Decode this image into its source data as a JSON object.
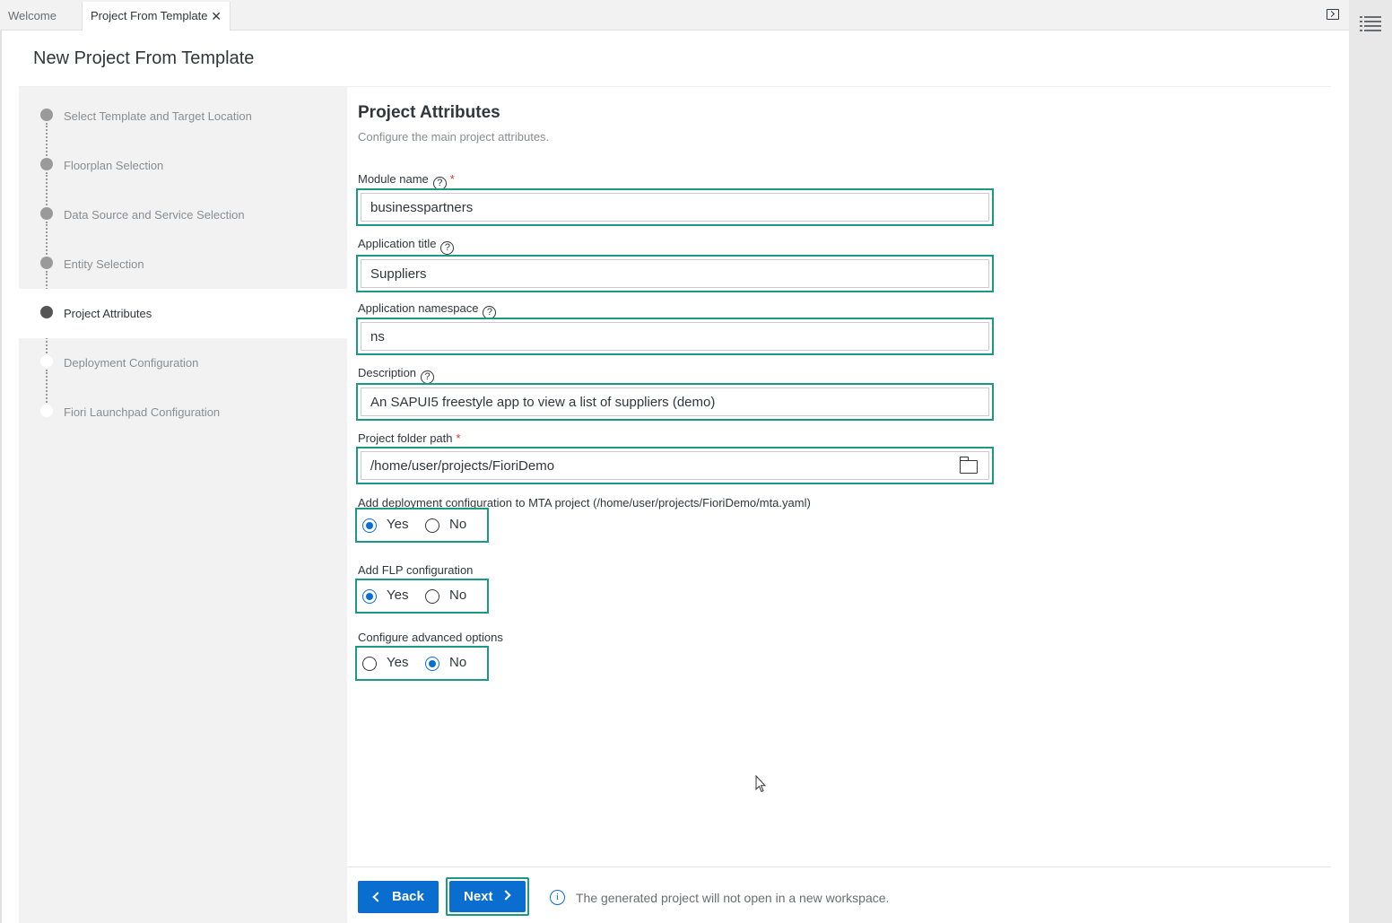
{
  "tabs": {
    "welcome": "Welcome",
    "active": "Project From Template",
    "close_glyph": "✕"
  },
  "page": {
    "title": "New Project From Template"
  },
  "wizard": {
    "steps": [
      {
        "label": "Select Template and Target Location",
        "state": "done"
      },
      {
        "label": "Floorplan Selection",
        "state": "done"
      },
      {
        "label": "Data Source and Service Selection",
        "state": "done"
      },
      {
        "label": "Entity Selection",
        "state": "done"
      },
      {
        "label": "Project Attributes",
        "state": "current"
      },
      {
        "label": "Deployment Configuration",
        "state": "future"
      },
      {
        "label": "Fiori Launchpad Configuration",
        "state": "future"
      }
    ]
  },
  "section": {
    "title": "Project Attributes",
    "subtitle": "Configure the main project attributes."
  },
  "fields": {
    "module_name": {
      "label": "Module name",
      "value": "businesspartners",
      "required": "*"
    },
    "app_title": {
      "label": "Application title",
      "value": "Suppliers"
    },
    "app_namespace": {
      "label": "Application namespace",
      "value": "ns"
    },
    "description": {
      "label": "Description",
      "value": "An SAPUI5 freestyle app to view a list of suppliers (demo)"
    },
    "folder_path": {
      "label": "Project folder path",
      "value": "/home/user/projects/FioriDemo",
      "required": "*"
    }
  },
  "radios": {
    "deployment": {
      "label": "Add deployment configuration to MTA project (/home/user/projects/FioriDemo/mta.yaml)",
      "yes": "Yes",
      "no": "No",
      "selected": "Yes"
    },
    "flp": {
      "label": "Add FLP configuration",
      "yes": "Yes",
      "no": "No",
      "selected": "Yes"
    },
    "advanced": {
      "label": "Configure advanced options",
      "yes": "Yes",
      "no": "No",
      "selected": "No"
    }
  },
  "help_glyph": "?",
  "footer": {
    "back": "Back",
    "next": "Next",
    "info_glyph": "i",
    "info": "The generated project will not open in a new workspace."
  },
  "colors": {
    "accent": "#0a6ed1",
    "highlight": "#1a9a84"
  }
}
